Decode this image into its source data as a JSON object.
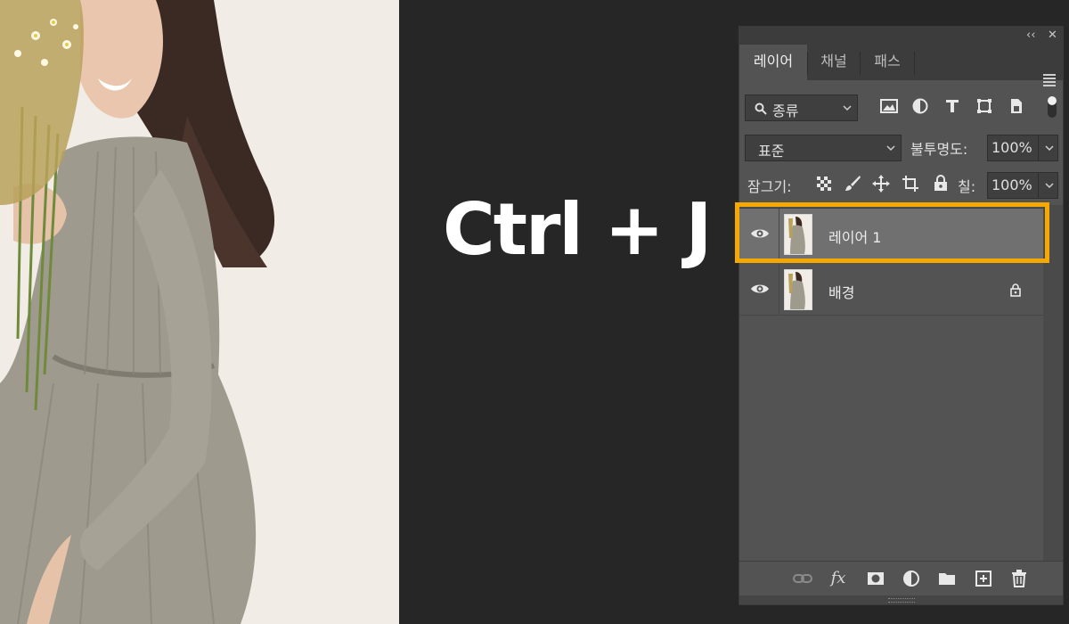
{
  "canvas": {
    "shortcut": "Ctrl + J",
    "highlight_color": "#f5a800"
  },
  "panel": {
    "collapse_icon": "‹‹",
    "close_icon": "✕",
    "tabs": [
      {
        "label": "레이어",
        "active": true
      },
      {
        "label": "채널",
        "active": false
      },
      {
        "label": "패스",
        "active": false
      }
    ],
    "filter": {
      "label": "종류",
      "icon": "search-icon"
    },
    "filter_icons": [
      "image-filter-icon",
      "adjustment-filter-icon",
      "type-filter-icon",
      "shape-filter-icon",
      "smart-object-filter-icon"
    ],
    "blend_mode": "표준",
    "opacity_label": "불투명도:",
    "opacity_value": "100%",
    "lock_label": "잠그기:",
    "lock_icons": [
      "lock-transparent-icon",
      "lock-image-icon",
      "lock-position-icon",
      "lock-artboard-icon",
      "lock-all-icon"
    ],
    "fill_label": "칠:",
    "fill_value": "100%",
    "layers": [
      {
        "name": "레이어 1",
        "selected": true,
        "locked": false,
        "visible": true
      },
      {
        "name": "배경",
        "selected": false,
        "locked": true,
        "visible": true
      }
    ],
    "footer_icons": [
      "link-layers-icon",
      "fx-icon",
      "add-mask-icon",
      "adjustment-layer-icon",
      "new-group-icon",
      "new-layer-icon",
      "delete-icon"
    ],
    "fx_label": "fx"
  }
}
